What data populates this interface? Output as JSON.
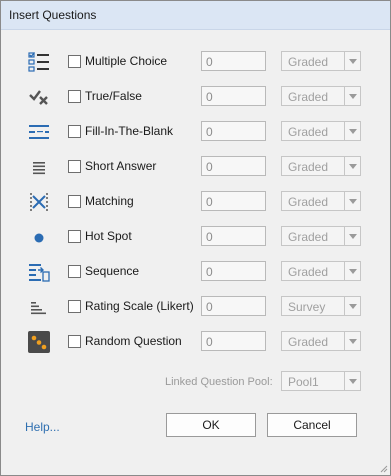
{
  "window": {
    "title": "Insert Questions"
  },
  "questions": [
    {
      "icon": "multiple-choice-icon",
      "label": "Multiple Choice",
      "count": "0",
      "grading": "Graded"
    },
    {
      "icon": "true-false-icon",
      "label": "True/False",
      "count": "0",
      "grading": "Graded"
    },
    {
      "icon": "fill-in-the-blank-icon",
      "label": "Fill-In-The-Blank",
      "count": "0",
      "grading": "Graded"
    },
    {
      "icon": "short-answer-icon",
      "label": "Short Answer",
      "count": "0",
      "grading": "Graded"
    },
    {
      "icon": "matching-icon",
      "label": "Matching",
      "count": "0",
      "grading": "Graded"
    },
    {
      "icon": "hot-spot-icon",
      "label": "Hot Spot",
      "count": "0",
      "grading": "Graded"
    },
    {
      "icon": "sequence-icon",
      "label": "Sequence",
      "count": "0",
      "grading": "Graded"
    },
    {
      "icon": "rating-scale-icon",
      "label": "Rating Scale (Likert)",
      "count": "0",
      "grading": "Survey"
    },
    {
      "icon": "random-question-icon",
      "label": "Random Question",
      "count": "0",
      "grading": "Graded"
    }
  ],
  "pool": {
    "label": "Linked Question Pool:",
    "value": "Pool1"
  },
  "footer": {
    "help": "Help...",
    "ok": "OK",
    "cancel": "Cancel"
  },
  "colors": {
    "icon_blue": "#2b6cb3",
    "icon_gray": "#555555",
    "icon_orange": "#f0a020",
    "title_bar": "#dbe6f4"
  }
}
